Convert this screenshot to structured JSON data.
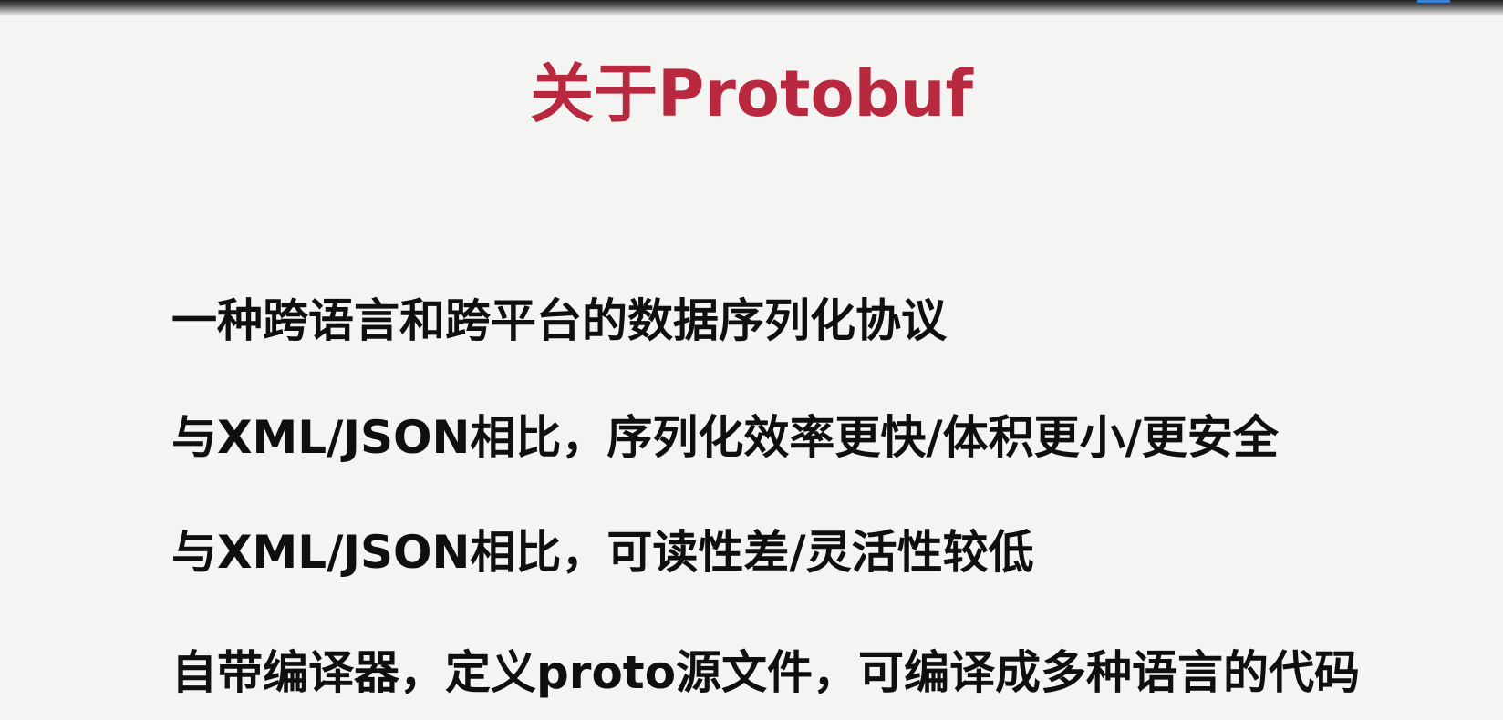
{
  "slide": {
    "title": "关于Protobuf",
    "bullets": [
      "一种跨语言和跨平台的数据序列化协议",
      "与XML/JSON相比，序列化效率更快/体积更小/更安全",
      "与XML/JSON相比，可读性差/灵活性较低",
      "自带编译器，定义proto源文件，可编译成多种语言的代码"
    ]
  },
  "colors": {
    "title": "#b8283e",
    "text": "#0f0f0f",
    "background": "#f4f4f3",
    "accent": "#3a7fd6"
  }
}
